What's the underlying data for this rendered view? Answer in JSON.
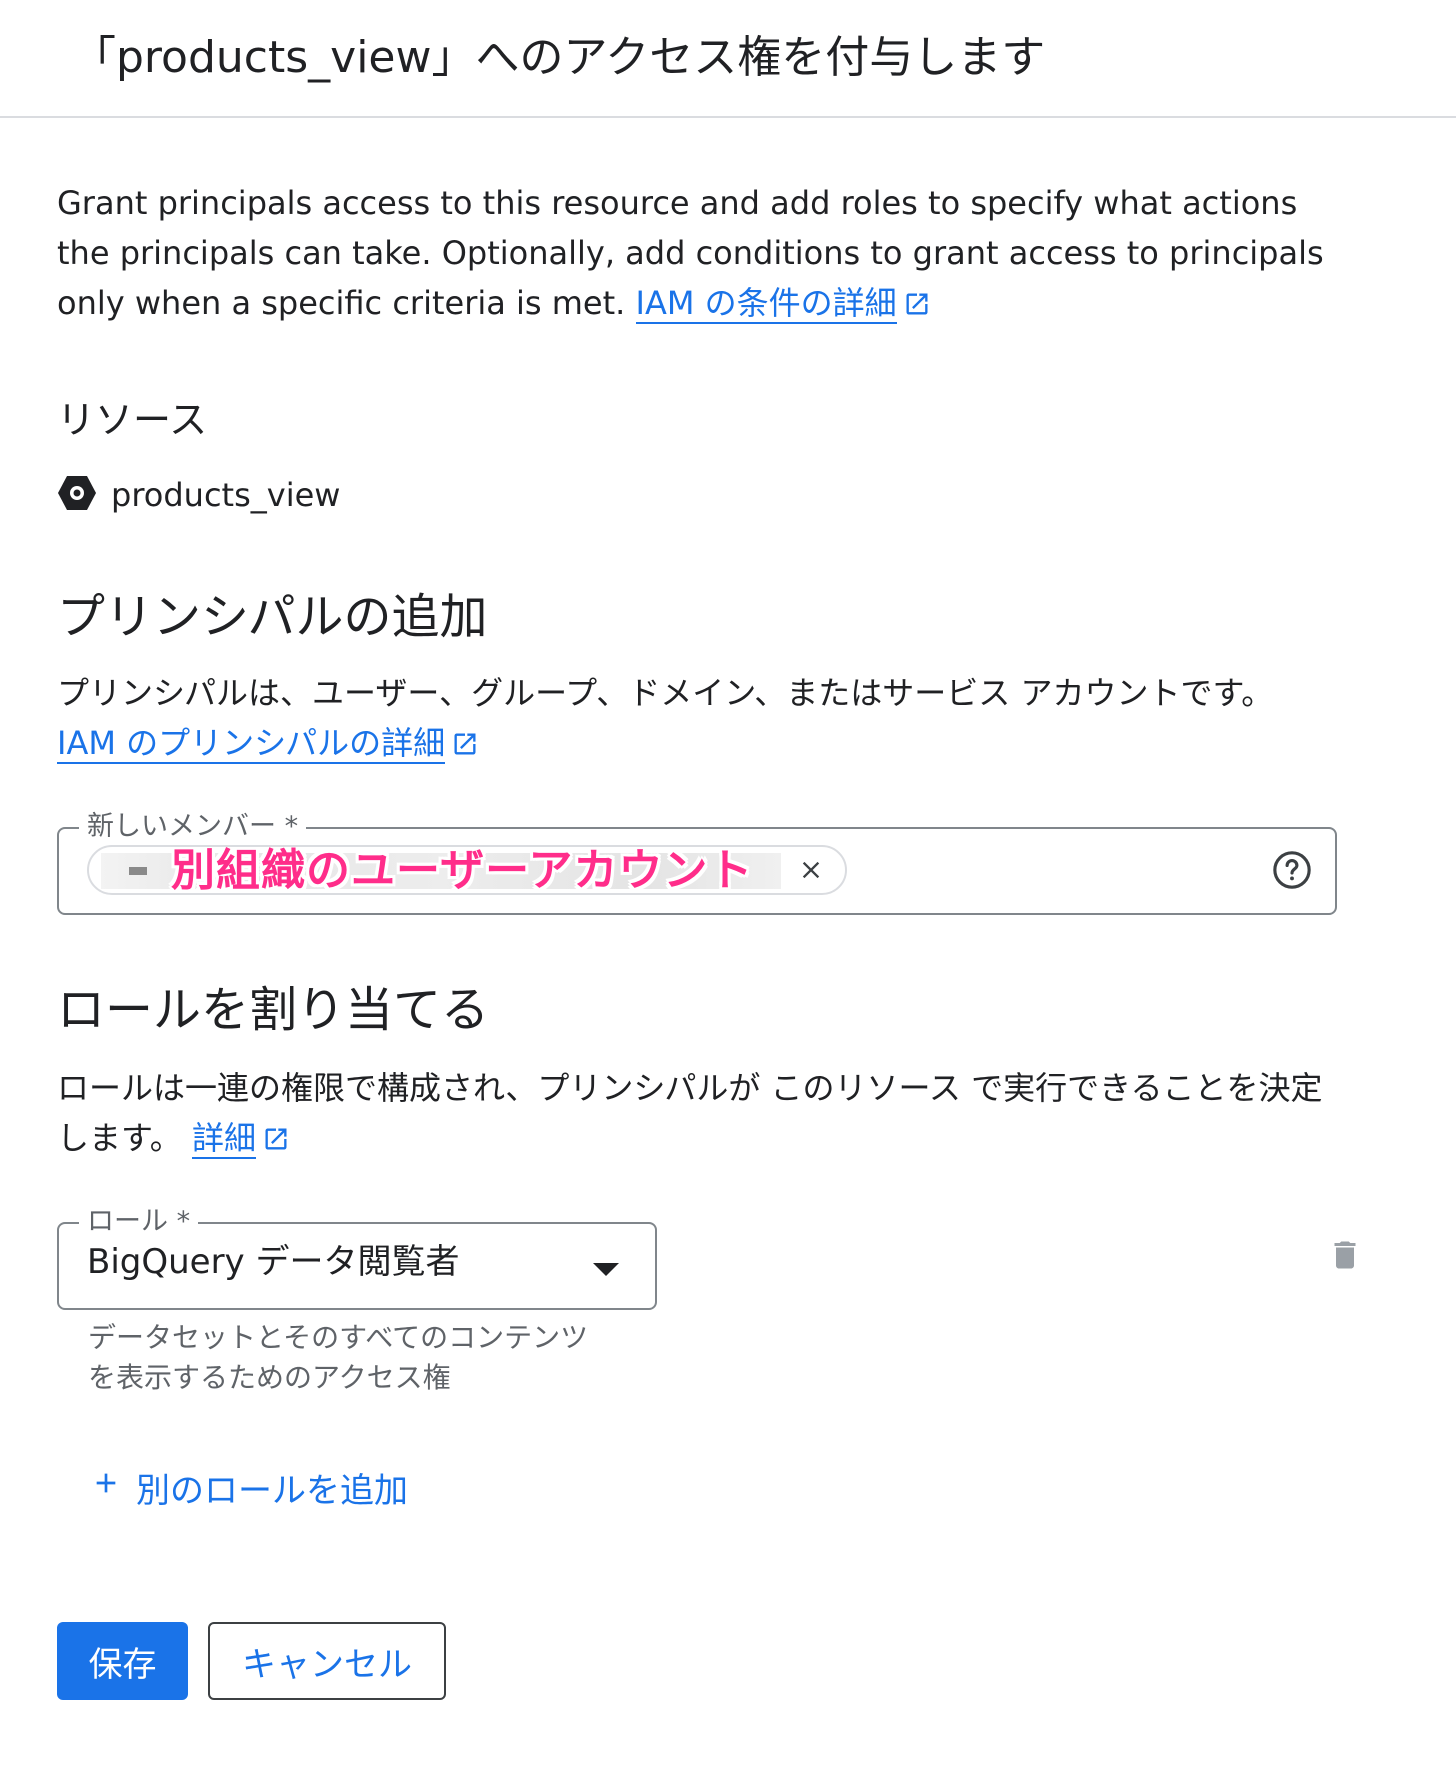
{
  "header": {
    "title": "「products_view」へのアクセス権を付与します"
  },
  "intro": {
    "text": "Grant principals access to this resource and add roles to specify what actions the principals can take. Optionally, add conditions to grant access to principals only when a specific criteria is met.",
    "link": "IAM の条件の詳細"
  },
  "resource": {
    "label": "リソース",
    "name": "products_view"
  },
  "principals": {
    "heading": "プリンシパルの追加",
    "description": "プリンシパルは、ユーザー、グループ、ドメイン、またはサービス アカウントです。",
    "link": "IAM のプリンシパルの詳細",
    "field_label": "新しいメンバー *",
    "overlay_annotation": "別組織のユーザーアカウント"
  },
  "roles": {
    "heading": "ロールを割り当てる",
    "description": "ロールは一連の権限で構成され、プリンシパルが このリソース で実行できることを決定します。",
    "link": "詳細",
    "field_label": "ロール *",
    "selected_role": "BigQuery データ閲覧者",
    "helper_text": "データセットとそのすべてのコンテンツを表示するためのアクセス権",
    "add_role_label": "別のロールを追加"
  },
  "actions": {
    "save": "保存",
    "cancel": "キャンセル"
  },
  "colors": {
    "accent": "#1a73e8",
    "annotation": "#ff2d8a",
    "border": "#80868b"
  }
}
